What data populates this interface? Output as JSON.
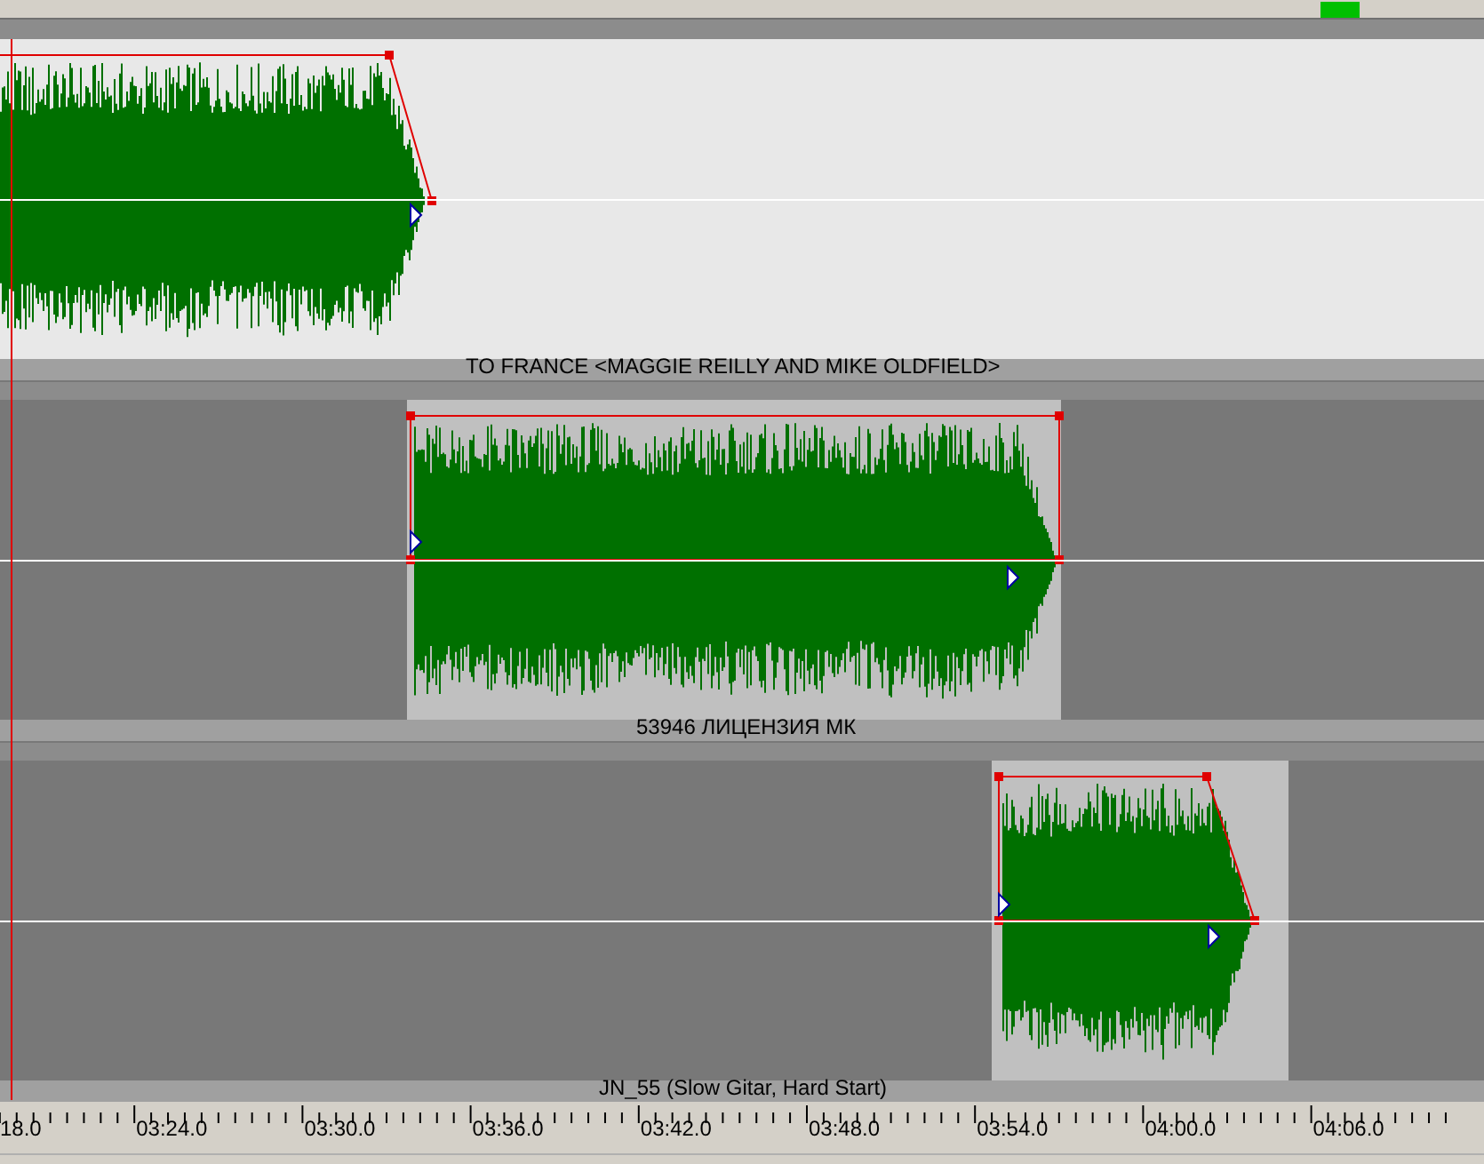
{
  "tracks": [
    {
      "label": "TO FRANCE <MAGGIE REILLY AND MIKE OLDFIELD>",
      "selected": true
    },
    {
      "label": "53946 ЛИЦЕНЗИЯ МК",
      "selected": false
    },
    {
      "label": "JN_55 (Slow Gitar, Hard Start)",
      "selected": false
    }
  ],
  "ruler": {
    "labels": [
      "18.0",
      "03:24.0",
      "03:30.0",
      "03:36.0",
      "03:42.0",
      "03:48.0",
      "03:54.0",
      "04:00.0",
      "04:06.0"
    ]
  }
}
